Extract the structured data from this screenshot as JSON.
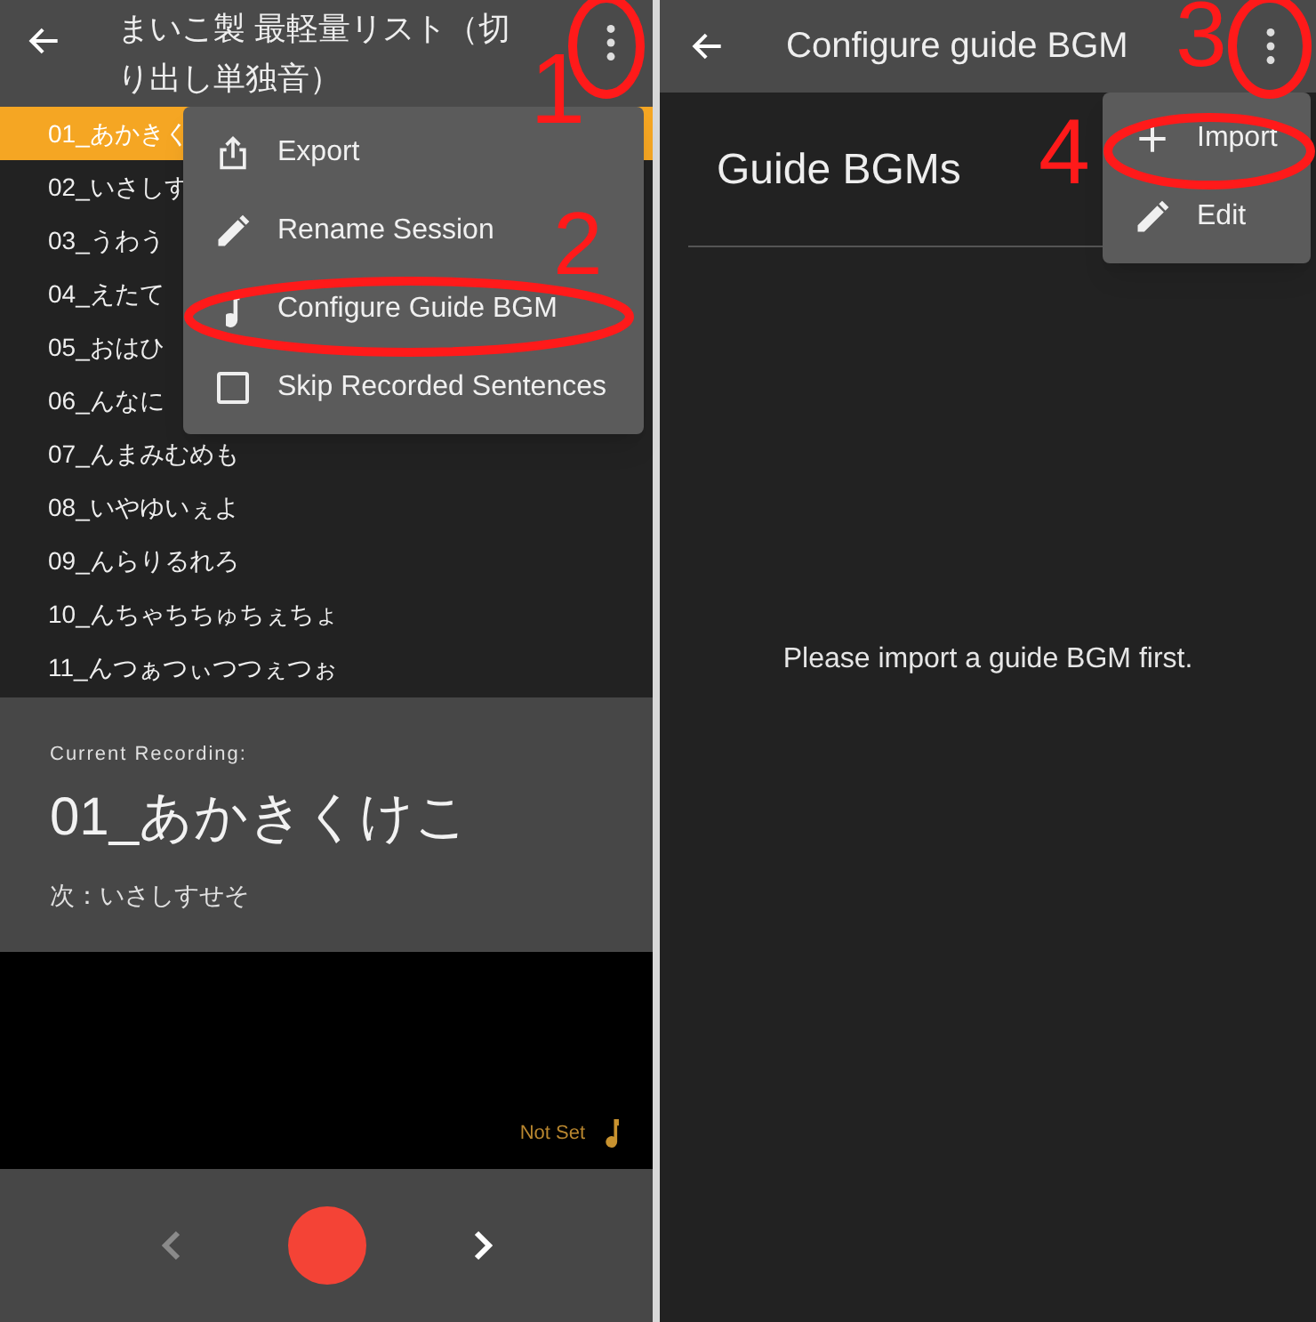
{
  "left_screen": {
    "title": "まいこ製 最軽量リスト（切り出し単独音）",
    "sentences": [
      {
        "label": "01_あかきく",
        "selected": true
      },
      {
        "label": "02_いさしす",
        "selected": false
      },
      {
        "label": "03_うわう",
        "selected": false
      },
      {
        "label": "04_えたて",
        "selected": false
      },
      {
        "label": "05_おはひ",
        "selected": false
      },
      {
        "label": "06_んなに",
        "selected": false
      },
      {
        "label": "07_んまみむめも",
        "selected": false
      },
      {
        "label": "08_いやゆいぇよ",
        "selected": false
      },
      {
        "label": "09_んらりるれろ",
        "selected": false
      },
      {
        "label": "10_んちゃちちゅちぇちょ",
        "selected": false
      },
      {
        "label": "11_んつぁつぃつつぇつぉ",
        "selected": false
      }
    ],
    "menu": [
      {
        "kind": "export",
        "label": "Export"
      },
      {
        "kind": "edit",
        "label": "Rename Session"
      },
      {
        "kind": "music",
        "label": "Configure Guide BGM"
      },
      {
        "kind": "checkbox",
        "label": "Skip Recorded Sentences",
        "checked": false
      }
    ],
    "current_recording": {
      "label": "Current Recording:",
      "value": "01_あかきくけこ",
      "next": "次：いさしすせそ"
    },
    "guide_bgm": {
      "label": "Not Set"
    },
    "controls": {
      "previous": {
        "disabled": true
      },
      "next": {
        "disabled": false
      }
    }
  },
  "right_screen": {
    "title": "Configure guide BGM",
    "heading": "Guide BGMs",
    "empty_message": "Please import a guide BGM first.",
    "menu": [
      {
        "kind": "add",
        "label": "Import"
      },
      {
        "kind": "edit",
        "label": "Edit"
      }
    ]
  },
  "annotations": [
    {
      "label": "1"
    },
    {
      "label": "2"
    },
    {
      "label": "3"
    },
    {
      "label": "4"
    }
  ]
}
